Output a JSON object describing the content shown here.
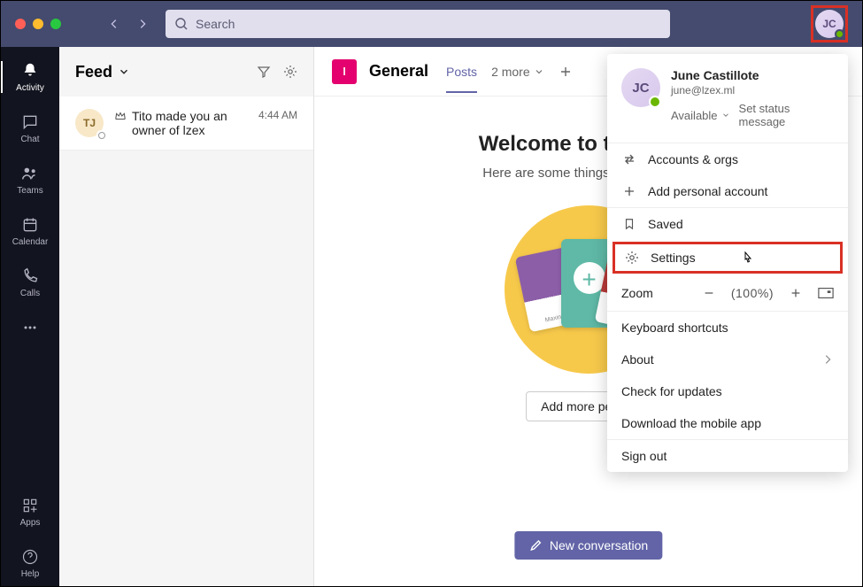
{
  "search": {
    "placeholder": "Search"
  },
  "user": {
    "initials": "JC",
    "name": "June Castillote",
    "email": "june@lzex.ml",
    "status": "Available"
  },
  "rail": {
    "activity": "Activity",
    "chat": "Chat",
    "teams": "Teams",
    "calendar": "Calendar",
    "calls": "Calls",
    "apps": "Apps",
    "help": "Help"
  },
  "feed": {
    "title": "Feed",
    "item": {
      "avatar": "TJ",
      "text": "Tito made you an owner of lzex",
      "time": "4:44 AM"
    }
  },
  "channel": {
    "tile": "l",
    "name": "General",
    "tabs": {
      "posts": "Posts",
      "more": "2 more"
    },
    "welcome_title": "Welcome to the team!",
    "welcome_sub": "Here are some things to get going...",
    "card_label": "Maxine",
    "add_more": "Add more people",
    "new_convo": "New conversation"
  },
  "menu": {
    "set_status": "Set status message",
    "accounts": "Accounts & orgs",
    "add_personal": "Add personal account",
    "saved": "Saved",
    "settings": "Settings",
    "zoom_label": "Zoom",
    "zoom_value": "(100%)",
    "shortcuts": "Keyboard shortcuts",
    "about": "About",
    "updates": "Check for updates",
    "download": "Download the mobile app",
    "signout": "Sign out"
  }
}
